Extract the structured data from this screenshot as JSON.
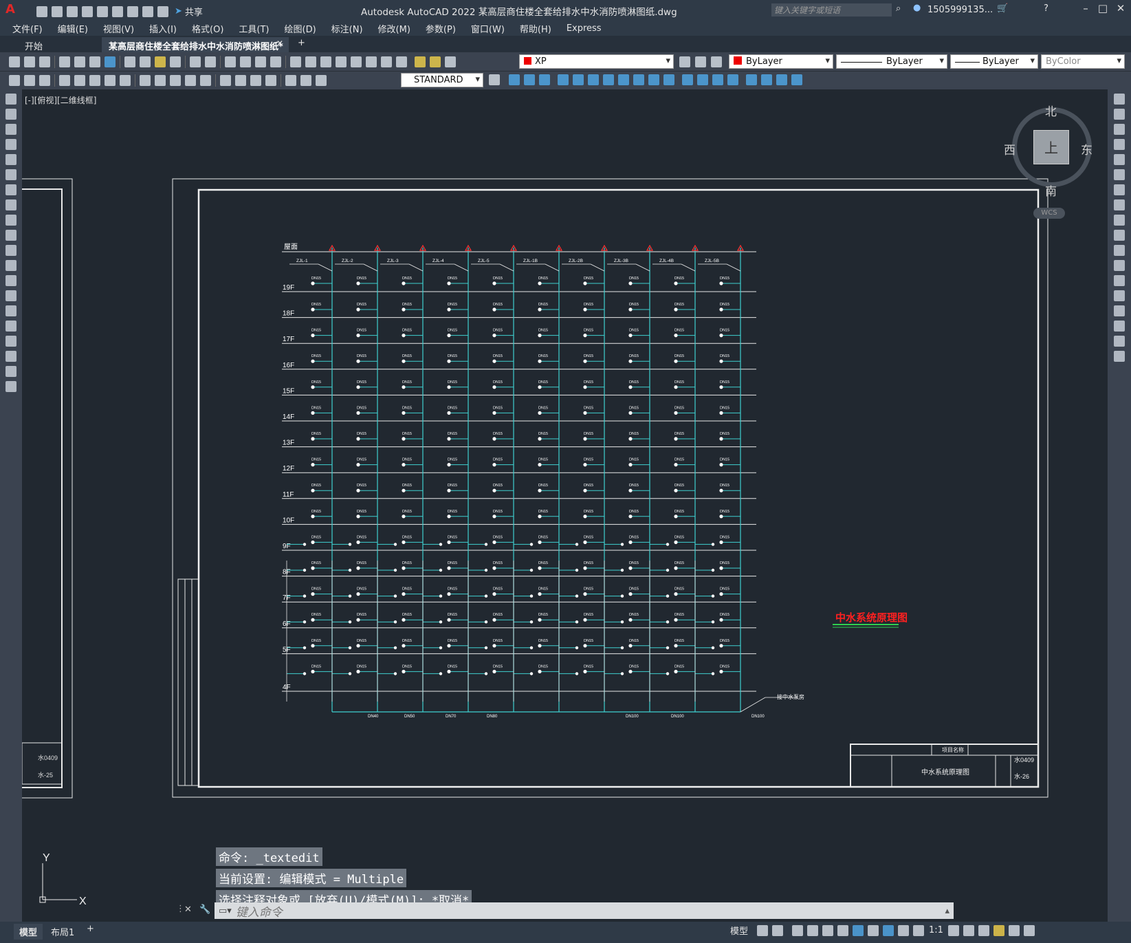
{
  "app": {
    "title": "Autodesk AutoCAD 2022 某高层商住楼全套给排水中水消防喷淋图纸.dwg",
    "share_label": "共享",
    "search_placeholder": "键入关键字或短语",
    "user": "1505999135...",
    "logo": "A"
  },
  "menu": [
    "文件(F)",
    "编辑(E)",
    "视图(V)",
    "插入(I)",
    "格式(O)",
    "工具(T)",
    "绘图(D)",
    "标注(N)",
    "修改(M)",
    "参数(P)",
    "窗口(W)",
    "帮助(H)",
    "Express"
  ],
  "tabs": {
    "start": "开始",
    "doc": "某高层商住楼全套给排水中水消防喷淋图纸*"
  },
  "toolbar": {
    "layer": "XP",
    "color": "ByLayer",
    "linetype": "ByLayer",
    "lineweight": "ByLayer",
    "plotstyle": "ByColor",
    "textstyle": "STANDARD"
  },
  "viewport": {
    "label": "[-][俯视][二维线框]"
  },
  "compass": {
    "north": "北",
    "south": "南",
    "east": "东",
    "west": "西",
    "top": "上",
    "wcs": "WCS"
  },
  "drawing": {
    "title": "中水系统原理图",
    "roof": "屋面",
    "floors": [
      "19F",
      "18F",
      "17F",
      "16F",
      "15F",
      "14F",
      "13F",
      "12F",
      "11F",
      "10F",
      "9F",
      "8F",
      "7F",
      "6F",
      "5F",
      "4F"
    ],
    "risers": [
      "ZJL-1",
      "ZJL-2",
      "ZJL-3",
      "ZJL-4",
      "ZJL-5",
      "ZJL-1B",
      "ZJL-2B",
      "ZJL-3B",
      "ZJL-4B",
      "ZJL-5B"
    ],
    "branch_label": "DN15",
    "bottom_labels": [
      "DN40",
      "DN50",
      "DN70",
      "DN80",
      "DN100",
      "DN100",
      "DN100"
    ],
    "side_note": "接中水泵房",
    "titleblock": {
      "project": "项目名称",
      "drawing": "中水系统原理图",
      "no": "水0409",
      "sheet": "水-26",
      "left_no": "水0409",
      "left_sheet": "水-25"
    }
  },
  "commands": [
    "命令: _textedit",
    "当前设置: 编辑模式 = Multiple",
    "选择注释对象或 [放弃(U)/模式(M)]: *取消*"
  ],
  "cmd_placeholder": "键入命令",
  "status": {
    "model_tab": "模型",
    "layout_tab": "布局1",
    "model_btn": "模型",
    "scale": "1:1"
  },
  "ucs": {
    "x": "X",
    "y": "Y"
  }
}
